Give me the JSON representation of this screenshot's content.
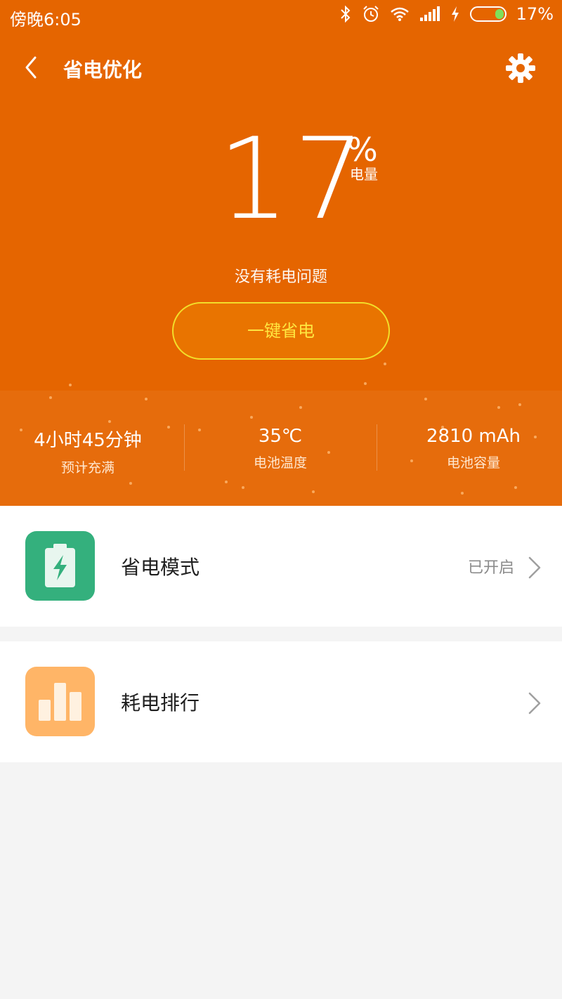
{
  "status_bar": {
    "time": "傍晚6:05",
    "battery_text": "17%",
    "icons": [
      "bluetooth-icon",
      "alarm-icon",
      "wifi-icon",
      "signal-icon",
      "charging-icon",
      "battery-icon"
    ]
  },
  "app_bar": {
    "title": "省电优化",
    "back_icon": "chevron-left-icon",
    "settings_icon": "gear-icon"
  },
  "battery": {
    "level": "17",
    "unit": "%",
    "label": "电量",
    "status": "没有耗电问题"
  },
  "action_button": {
    "label": "一键省电"
  },
  "stats": [
    {
      "value": "4小时45分钟",
      "label": "预计充满"
    },
    {
      "value": "35℃",
      "label": "电池温度"
    },
    {
      "value": "2810 mAh",
      "label": "电池容量"
    }
  ],
  "list": [
    {
      "label": "省电模式",
      "status": "已开启",
      "icon": "battery-charging-icon",
      "icon_color": "#34b07d"
    },
    {
      "label": "耗电排行",
      "status": "",
      "icon": "bar-chart-icon",
      "icon_color": "#ffb567"
    }
  ],
  "colors": {
    "hero": "#e56500",
    "stats_band": "#e66c0c",
    "button_border": "#f2de2a",
    "button_text": "#ffe640"
  }
}
